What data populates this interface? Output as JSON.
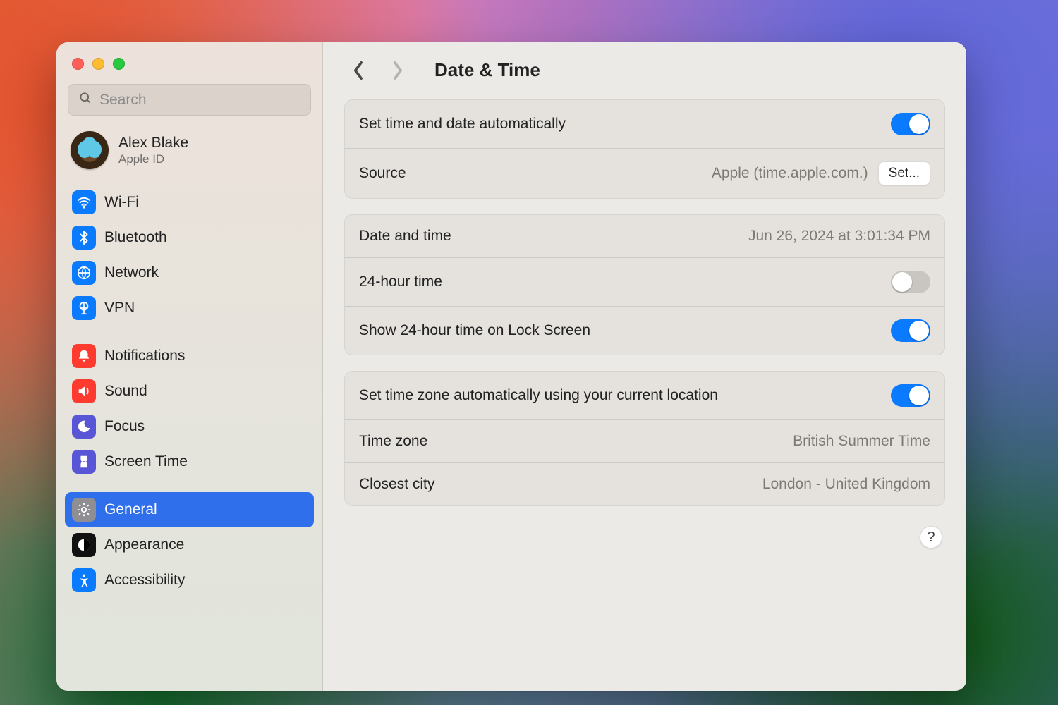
{
  "search": {
    "placeholder": "Search"
  },
  "account": {
    "name": "Alex Blake",
    "sub": "Apple ID"
  },
  "sidebar": {
    "items": [
      {
        "label": "Wi-Fi"
      },
      {
        "label": "Bluetooth"
      },
      {
        "label": "Network"
      },
      {
        "label": "VPN"
      },
      {
        "label": "Notifications"
      },
      {
        "label": "Sound"
      },
      {
        "label": "Focus"
      },
      {
        "label": "Screen Time"
      },
      {
        "label": "General"
      },
      {
        "label": "Appearance"
      },
      {
        "label": "Accessibility"
      }
    ]
  },
  "header": {
    "title": "Date & Time"
  },
  "rows": {
    "auto_time_label": "Set time and date automatically",
    "source_label": "Source",
    "source_value": "Apple (time.apple.com.)",
    "set_button": "Set...",
    "date_time_label": "Date and time",
    "date_time_value": "Jun 26, 2024 at 3:01:34 PM",
    "h24_label": "24-hour time",
    "h24_lock_label": "Show 24-hour time on Lock Screen",
    "auto_tz_label": "Set time zone automatically using your current location",
    "tz_label": "Time zone",
    "tz_value": "British Summer Time",
    "city_label": "Closest city",
    "city_value": "London - United Kingdom"
  },
  "toggles": {
    "auto_time": true,
    "h24": false,
    "h24_lock": true,
    "auto_tz": true
  },
  "help": "?"
}
